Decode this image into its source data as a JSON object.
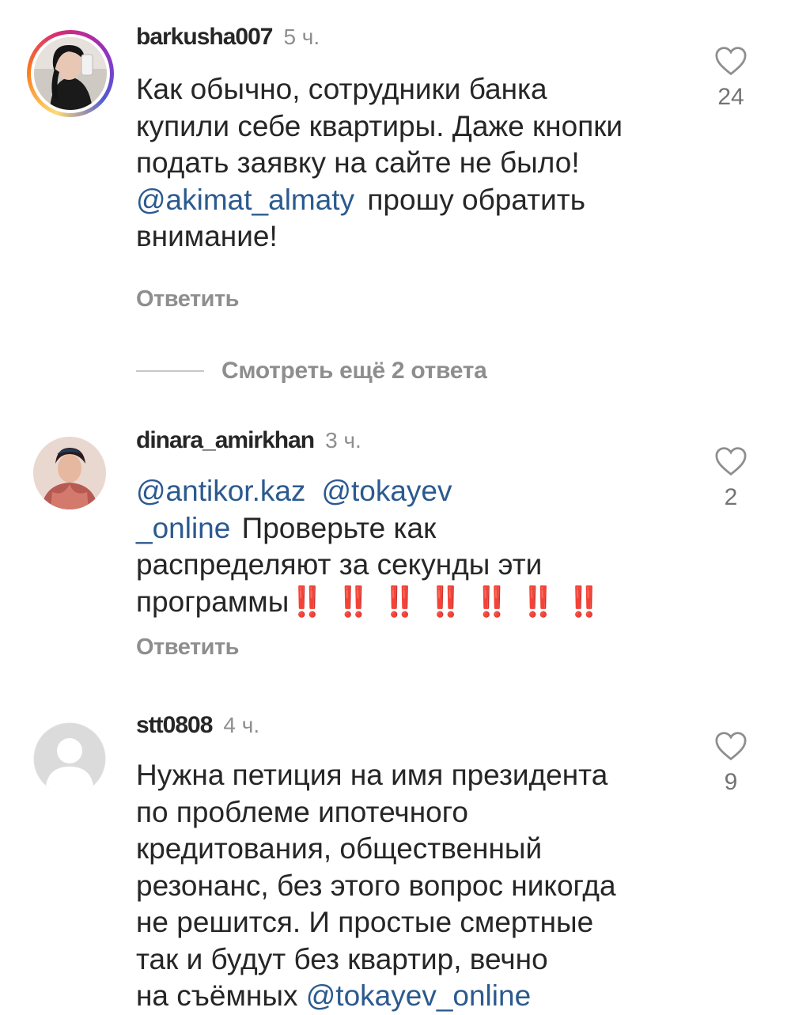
{
  "comments": [
    {
      "username": "barkusha007",
      "time": "5 ч.",
      "lines": [
        "Как обычно, сотрудники банка",
        "купили себе квартиры. Даже кнопки",
        "подать заявку на сайте не было!"
      ],
      "mention1": "@akimat_almaty",
      "after_mention1": " прошу обратить",
      "last_line": "внимание!",
      "likes": "24",
      "reply_label": "Ответить",
      "has_story": true
    },
    {
      "username": "dinara_amirkhan",
      "time": "3 ч.",
      "mention1": "@antikor.kaz",
      "mention2": "@tokayev",
      "mention2_cont": "_online",
      "line2_text": " Проверьте как",
      "line3": "распределяют за секунды эти",
      "line4": "программы",
      "exclamations": "‼️ ‼️ ‼️ ‼️ ‼️ ‼️ ‼️",
      "likes": "2",
      "reply_label": "Ответить"
    },
    {
      "username": "stt0808",
      "time": "4 ч.",
      "lines": [
        "Нужна петиция на имя президента",
        "по проблеме ипотечного",
        "кредитования, общественный",
        "резонанс, без этого вопрос никогда",
        "не решится. И простые смертные",
        "так и будут без квартир, вечно"
      ],
      "last_prefix": "на съёмных ",
      "last_mention": "@tokayev_online",
      "likes": "9"
    }
  ],
  "view_more_replies": "Смотреть ещё 2 ответа",
  "colors": {
    "mention": "#2b5a8f",
    "secondary": "#8e8e8e",
    "exclamation": "#d4001c"
  },
  "icons": [
    "heart-outline-icon",
    "default-avatar-icon"
  ]
}
